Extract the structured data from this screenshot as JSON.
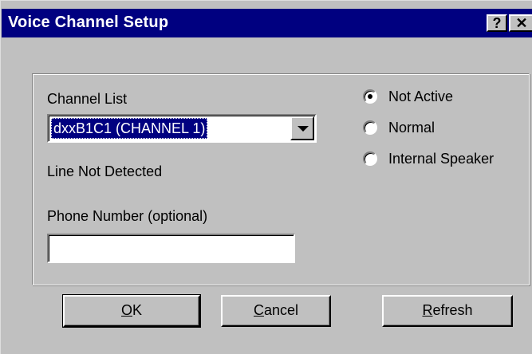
{
  "window": {
    "title": "Voice Channel Setup",
    "help_button": "?",
    "close_button": "✕"
  },
  "channel": {
    "label": "Channel List",
    "selected": "dxxB1C1 (CHANNEL 1)",
    "status": "Line Not Detected"
  },
  "phone": {
    "label": "Phone Number (optional)",
    "value": ""
  },
  "mode": {
    "options": [
      {
        "label": "Not Active",
        "selected": true
      },
      {
        "label": "Normal",
        "selected": false
      },
      {
        "label": "Internal Speaker",
        "selected": false
      }
    ]
  },
  "buttons": {
    "ok": {
      "mnemonic": "O",
      "rest": "K"
    },
    "cancel": {
      "mnemonic": "C",
      "rest": "ancel"
    },
    "refresh": {
      "mnemonic": "R",
      "rest": "efresh"
    }
  }
}
